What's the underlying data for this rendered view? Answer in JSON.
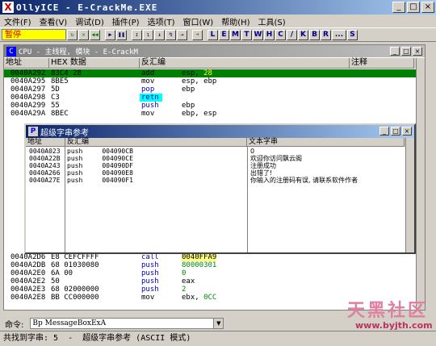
{
  "window": {
    "title": "OllyICE - E-CrackMe.EXE",
    "logo": "X",
    "min": "_",
    "max": "□",
    "close": "×"
  },
  "menu": [
    "文件(F)",
    "查看(V)",
    "调试(D)",
    "插件(P)",
    "选项(T)",
    "窗口(W)",
    "帮助(H)",
    "工具(S)"
  ],
  "toolbar": {
    "status": "暂停",
    "letters": [
      "L",
      "E",
      "M",
      "T",
      "W",
      "H",
      "C",
      "/",
      "K",
      "B",
      "R",
      "...",
      "S"
    ]
  },
  "cpu": {
    "title": "CPU - 主线程, 模块 - E-CrackM",
    "cols": {
      "addr": "地址",
      "hex": "HEX 数据",
      "dis": "反汇编",
      "cmt": "注释"
    },
    "rows": [
      {
        "a": "0040A292",
        "h": "83C4 28",
        "m": "add",
        "o": "esp, ",
        "o2": "28"
      },
      {
        "a": "0040A295",
        "h": "8BE5",
        "m": "mov",
        "o": "esp, ebp",
        "o2": ""
      },
      {
        "a": "0040A297",
        "h": "5D",
        "m": "pop",
        "o": "ebp",
        "o2": ""
      },
      {
        "a": "0040A298",
        "h": "C3",
        "m": "retn",
        "o": "",
        "o2": ""
      },
      {
        "a": "0040A299",
        "h": "55",
        "m": "push",
        "o": "ebp",
        "o2": ""
      },
      {
        "a": "0040A29A",
        "h": "8BEC",
        "m": "mov",
        "o": "ebp, esp",
        "o2": ""
      }
    ],
    "rows2": [
      {
        "a": "0040A2D6",
        "h": "E8 CEFCFFFF",
        "m": "call",
        "o": "",
        "o2": "0040FFA9"
      },
      {
        "a": "0040A2DB",
        "h": "68 01030080",
        "m": "push",
        "o": "",
        "o2": "80000301"
      },
      {
        "a": "0040A2E0",
        "h": "6A 00",
        "m": "push",
        "o": "0",
        "o2": ""
      },
      {
        "a": "0040A2E2",
        "h": "50",
        "m": "push",
        "o": "eax",
        "o2": ""
      },
      {
        "a": "0040A2E3",
        "h": "68 02000000",
        "m": "push",
        "o": "2",
        "o2": ""
      },
      {
        "a": "0040A2E8",
        "h": "BB CC000000",
        "m": "mov",
        "o": "ebx, ",
        "o2": "0CC"
      }
    ]
  },
  "strings": {
    "title": "超级字串参考",
    "cols": {
      "addr": "地址",
      "dis": "反汇编",
      "text": "文本字串"
    },
    "rows": [
      {
        "a": "0040A023",
        "d": "push     004090CB",
        "t": "0"
      },
      {
        "a": "0040A22B",
        "d": "push     004090CE",
        "t": "欢迎你访问飘云阁"
      },
      {
        "a": "0040A243",
        "d": "push     004090DF",
        "t": "注册成功"
      },
      {
        "a": "0040A266",
        "d": "push     004090E8",
        "t": "出错了!"
      },
      {
        "a": "0040A27E",
        "d": "push     004090F1",
        "t": "你输入的注册码有误, 请联系软件作者"
      }
    ]
  },
  "command": {
    "label": "命令:",
    "value": "Bp MessageBoxExA"
  },
  "status": "共找到字串: 5  -  超级字串参考 (ASCII 模式)",
  "watermark": {
    "text": "天黑社区",
    "url": "www.byjth.com"
  }
}
